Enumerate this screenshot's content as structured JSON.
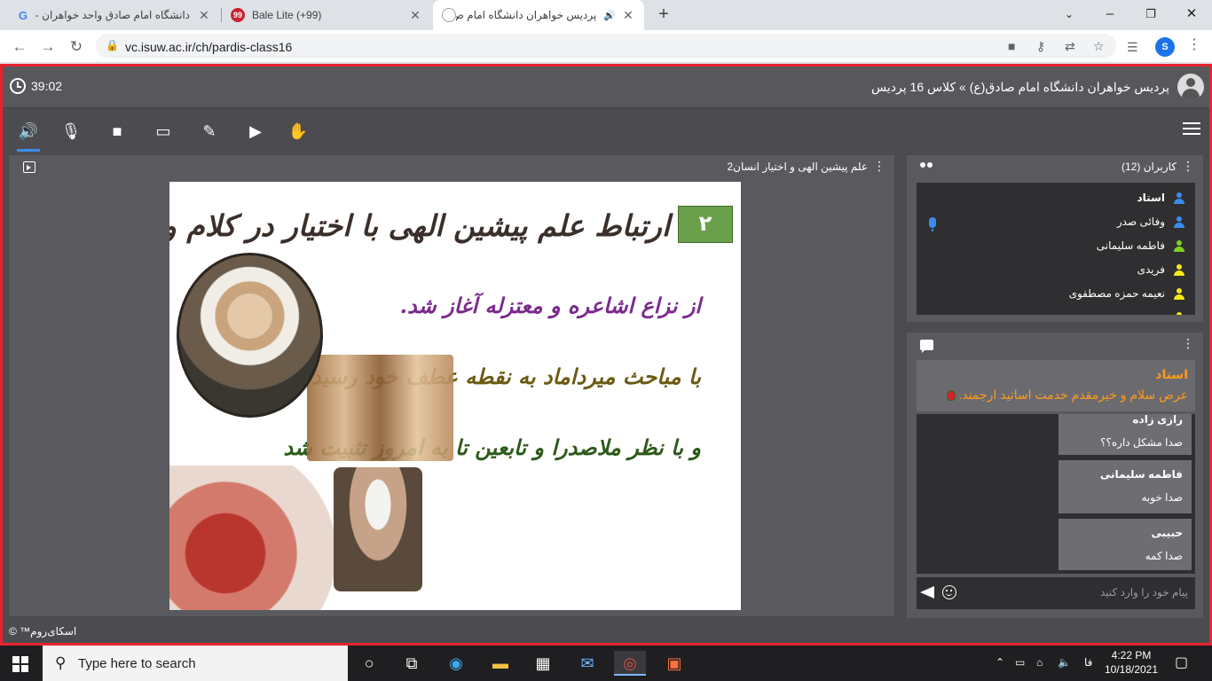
{
  "browser": {
    "tabs": [
      {
        "title": "دانشگاه امام صادق واحد خواهران -",
        "favicon": "google-icon"
      },
      {
        "title": "Bale Lite (+99)",
        "favicon": "bale-icon",
        "badge": "99"
      },
      {
        "title": "پردیس خواهران دانشگاه امام ص",
        "favicon": "skyroom-icon",
        "audio": true,
        "active": true
      }
    ],
    "url": "vc.isuw.ac.ir/ch/pardis-class16",
    "profile_initial": "S"
  },
  "app": {
    "timer": "39:02",
    "room_title": "پردیس خواهران دانشگاه امام صادق(ع) » کلاس 16 پردیس",
    "tools": [
      "speaker-icon",
      "mic-muted-icon",
      "camera-icon",
      "screen-share-icon",
      "brush-icon",
      "play-icon",
      "hand-icon"
    ],
    "presentation": {
      "title": "علم پیشین الهی و اختیار انسان2",
      "slide": {
        "number": "۲",
        "line1": "ارتباط علم پیشین الهی با اختیار در کلام و فلسفه اسلامی",
        "line2": "از نزاع اشاعره و معتزله آغاز شد.",
        "line3": "با مباحث میرداماد به نقطه عطف خود رسید",
        "line4": "و با نظر ملاصدرا و تابعین تا به امروز تثبیت شد"
      }
    },
    "users": {
      "title": "کاربران (12)",
      "list": [
        {
          "name": "استاد",
          "color": "#3b8cf0",
          "host": true
        },
        {
          "name": "وفائی صدر",
          "color": "#3b8cf0"
        },
        {
          "name": "فاطمه سلیمانی",
          "color": "#7ed321"
        },
        {
          "name": "فریدی",
          "color": "#f8e71c"
        },
        {
          "name": "نعیمه حمزه مصطفوی",
          "color": "#f8e71c"
        },
        {
          "name": "...",
          "color": "#f8e71c"
        }
      ]
    },
    "chat": {
      "pinned_name": "استاد",
      "pinned_text": "عرض سلام و خیرمقدم خدمت اساتید ارجمند.",
      "messages": [
        {
          "name": "رازی زاده",
          "text": "صدا مشکل داره؟؟"
        },
        {
          "name": "فاطمه سلیمانی",
          "text": "صدا خوبه"
        },
        {
          "name": "حبیبی",
          "text": "صدا کمه"
        }
      ],
      "input_placeholder": "پیام خود را وارد کنید"
    },
    "footer": "اسکای‌روم™ ©"
  },
  "taskbar": {
    "search_placeholder": "Type here to search",
    "lang": "فا",
    "time": "4:22 PM",
    "date": "10/18/2021"
  }
}
